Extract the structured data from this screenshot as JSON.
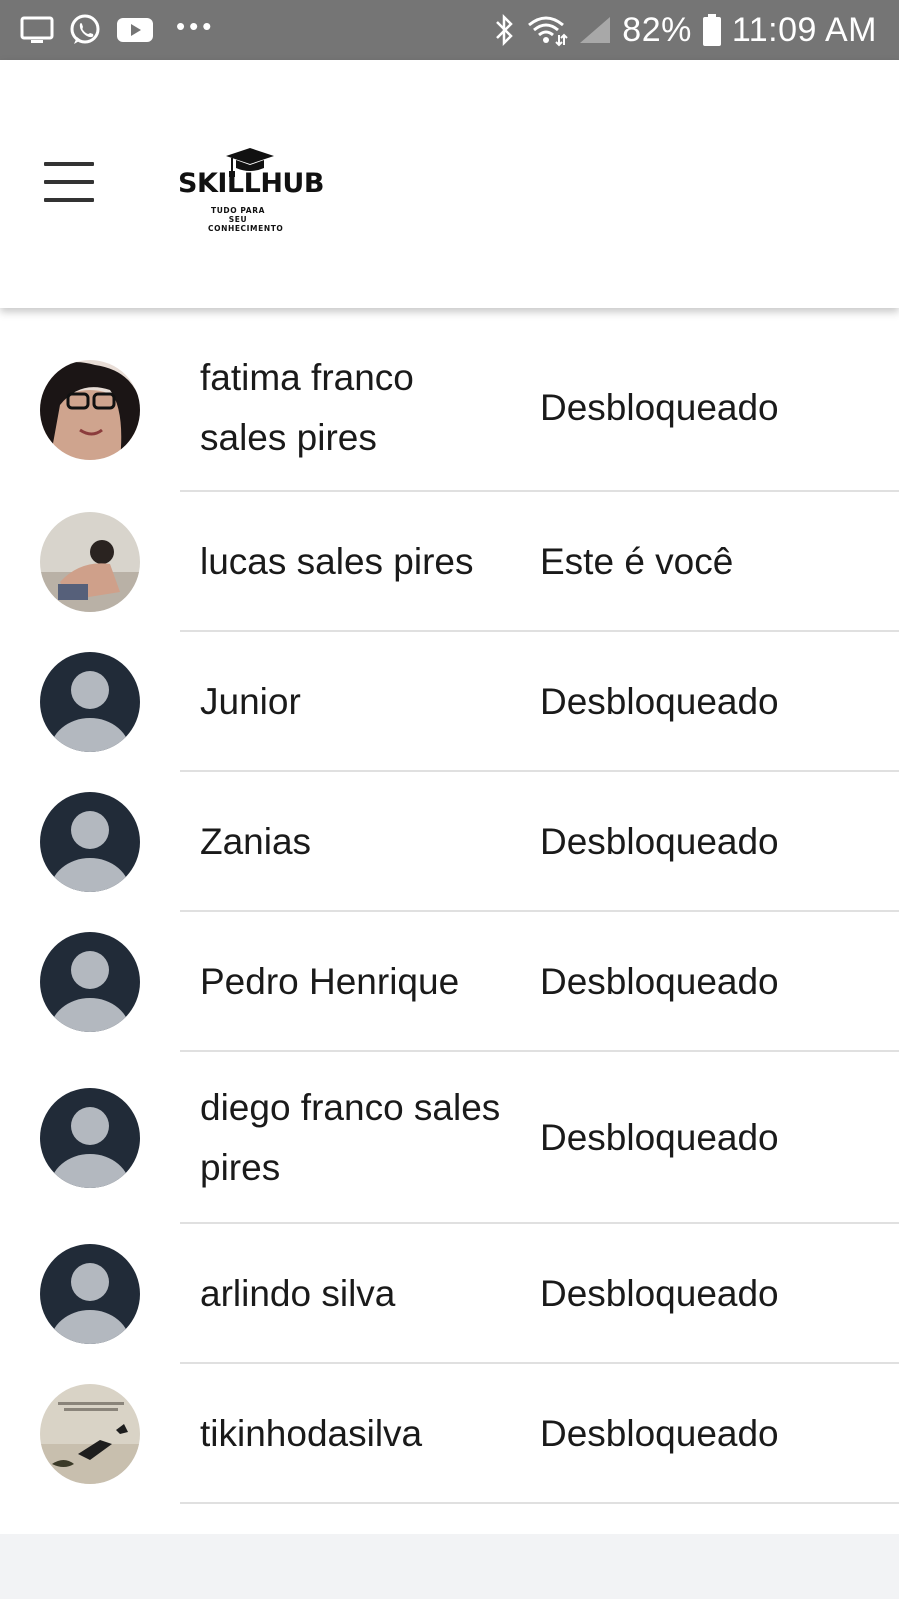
{
  "status_bar": {
    "battery": "82%",
    "time": "11:09 AM",
    "icons": [
      "screen-cast-icon",
      "whatsapp-icon",
      "youtube-icon",
      "more-dots-icon",
      "bluetooth-icon",
      "wifi-icon",
      "signal-icon",
      "battery-icon"
    ]
  },
  "header": {
    "menu_icon": "hamburger-menu-icon",
    "logo": {
      "name": "SKILLHUB",
      "tagline_1": "TUDO PARA SEU",
      "tagline_2": "CONHECIMENTO"
    }
  },
  "members": [
    {
      "name": "fatima franco sales pires",
      "status": "Desbloqueado",
      "avatar": "photo"
    },
    {
      "name": "lucas sales pires",
      "status": "Este é você",
      "avatar": "photo"
    },
    {
      "name": "Junior",
      "status": "Desbloqueado",
      "avatar": "default"
    },
    {
      "name": "Zanias",
      "status": "Desbloqueado",
      "avatar": "default"
    },
    {
      "name": "Pedro Henrique",
      "status": "Desbloqueado",
      "avatar": "default"
    },
    {
      "name": "diego franco sales pires",
      "status": "Desbloqueado",
      "avatar": "default"
    },
    {
      "name": "arlindo silva",
      "status": "Desbloqueado",
      "avatar": "default"
    },
    {
      "name": "tikinhodasilva",
      "status": "Desbloqueado",
      "avatar": "photo"
    }
  ],
  "colors": {
    "status_bar": "#757575",
    "default_avatar_bg": "#212b38",
    "default_avatar_fg": "#b3b8bf",
    "divider": "#e0e0e0",
    "page_bg": "#f2f3f5"
  }
}
